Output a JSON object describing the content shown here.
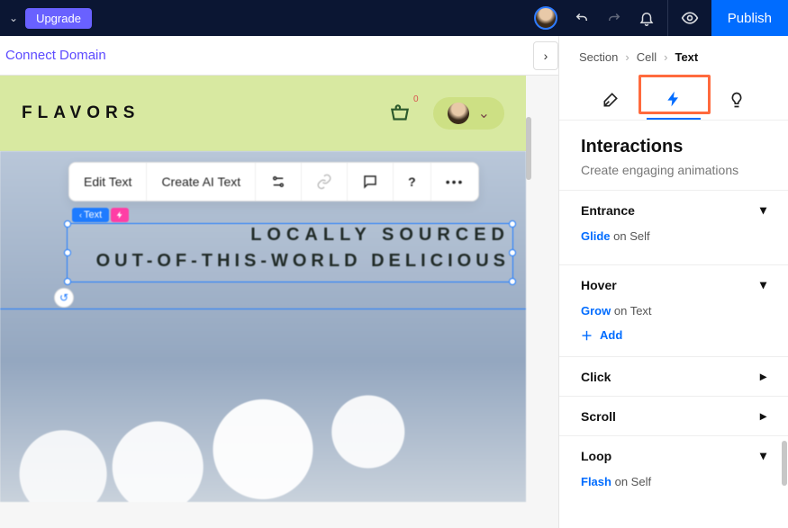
{
  "topbar": {
    "upgrade": "Upgrade",
    "publish": "Publish"
  },
  "subbar": {
    "connect_domain": "Connect Domain"
  },
  "site": {
    "brand": "FLAVORS",
    "cart_count": "0",
    "hero_line1": "LOCALLY SOURCED",
    "hero_line2": "OUT-OF-THIS-WORLD DELICIOUS"
  },
  "toolbar": {
    "edit_text": "Edit Text",
    "create_ai": "Create AI Text"
  },
  "selection": {
    "chip_label": "Text"
  },
  "breadcrumb": {
    "section": "Section",
    "cell": "Cell",
    "text": "Text"
  },
  "panel": {
    "title": "Interactions",
    "subtitle": "Create engaging animations"
  },
  "accordion": {
    "entrance": {
      "title": "Entrance",
      "effect": "Glide",
      "on": "on Self"
    },
    "hover": {
      "title": "Hover",
      "effect": "Grow",
      "on": "on Text",
      "add": "Add"
    },
    "click": {
      "title": "Click"
    },
    "scroll": {
      "title": "Scroll"
    },
    "loop": {
      "title": "Loop",
      "effect": "Flash",
      "on": "on Self"
    }
  }
}
